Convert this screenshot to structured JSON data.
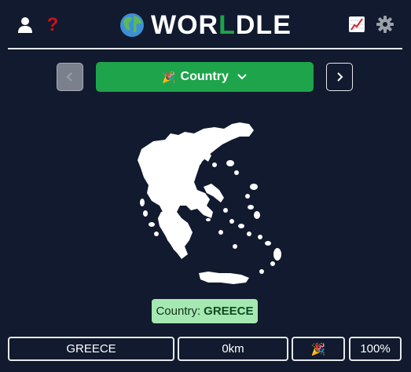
{
  "header": {
    "title_prefix": "WOR",
    "title_accent": "L",
    "title_suffix": "DLE",
    "help_symbol": "?",
    "icons": [
      "user-icon",
      "help-icon",
      "globe-icon",
      "stats-icon",
      "gear-icon"
    ]
  },
  "category": {
    "emoji": "🎉",
    "label": "Country",
    "prev_symbol": "‹",
    "next_symbol": "›"
  },
  "answer": {
    "label": "Country:",
    "value": "GREECE"
  },
  "guess": {
    "country": "GREECE",
    "distance": "0km",
    "direction": "🎉",
    "percent": "100%"
  },
  "colors": {
    "background": "#111a2e",
    "accent_green": "#1ea44a",
    "answer_bg": "#a5e8b1",
    "help_red": "#c8141e"
  }
}
